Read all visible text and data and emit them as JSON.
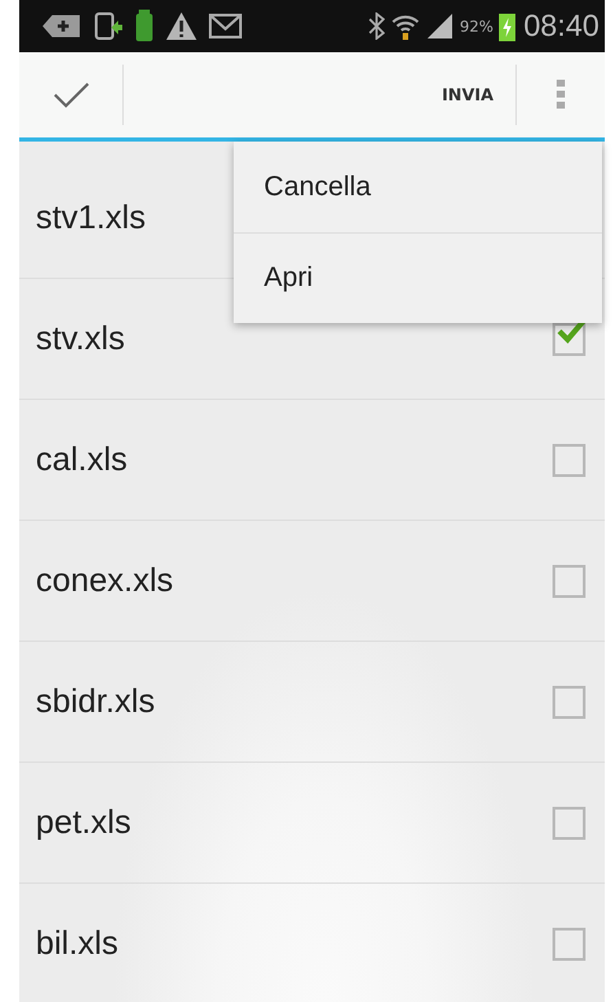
{
  "status_bar": {
    "battery_percent": "92%",
    "time": "08:40"
  },
  "action_bar": {
    "send_label": "INVIA"
  },
  "files": [
    {
      "name": "stv1.xls"
    },
    {
      "name": "stv.xls",
      "checked": true
    },
    {
      "name": "cal.xls",
      "checked": false
    },
    {
      "name": "conex.xls",
      "checked": false
    },
    {
      "name": "sbidr.xls",
      "checked": false
    },
    {
      "name": "pet.xls",
      "checked": false
    },
    {
      "name": "bil.xls",
      "checked": false
    }
  ],
  "menu": {
    "items": [
      {
        "label": "Cancella"
      },
      {
        "label": "Apri"
      }
    ]
  }
}
